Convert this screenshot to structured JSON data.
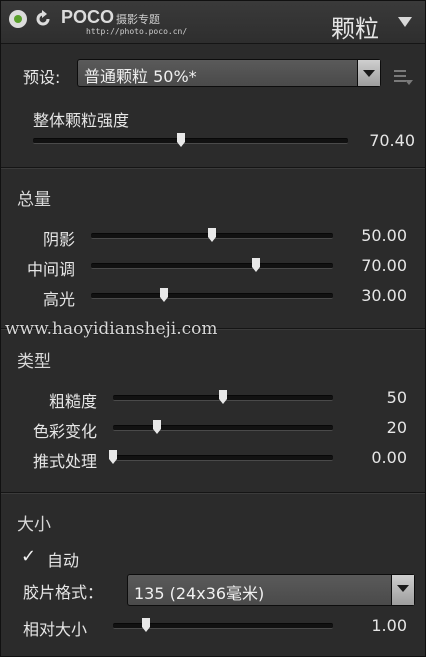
{
  "header": {
    "logo_main": "POCO",
    "logo_sub": "摄影专题",
    "logo_url": "http://photo.poco.cn/",
    "panel_title": "颗粒"
  },
  "preset": {
    "label": "预设:",
    "value": "普通颗粒 50%*"
  },
  "overall": {
    "label": "整体颗粒强度",
    "value": "70.40",
    "level": 0.47
  },
  "amount": {
    "title": "总量",
    "sliders": [
      {
        "label": "阴影",
        "value": "50.00",
        "level": 0.5
      },
      {
        "label": "中间调",
        "value": "70.00",
        "level": 0.68
      },
      {
        "label": "高光",
        "value": "30.00",
        "level": 0.3
      }
    ]
  },
  "watermark": "www.haoyidiansheji.com",
  "type": {
    "title": "类型",
    "sliders": [
      {
        "label": "粗糙度",
        "value": "50",
        "level": 0.5
      },
      {
        "label": "色彩变化",
        "value": "20",
        "level": 0.2
      },
      {
        "label": "推式处理",
        "value": "0.00",
        "level": 0.0
      }
    ]
  },
  "size": {
    "title": "大小",
    "auto_checkbox_label": "自动",
    "auto_checked": true,
    "film_format_label": "胶片格式：",
    "film_format_value": "135 (24x36毫米)",
    "relative_label": "相对大小",
    "relative_value": "1.00",
    "relative_level": 0.15
  },
  "colors": {
    "panel_bg": "#2b2b2b",
    "text": "#e6e6e6",
    "enable_dot": "#5aa02c"
  },
  "icons": {
    "enable": "power-toggle-icon",
    "reset": "reset-icon",
    "collapse": "triangle-down-icon",
    "preset_menu": "list-menu-icon"
  }
}
